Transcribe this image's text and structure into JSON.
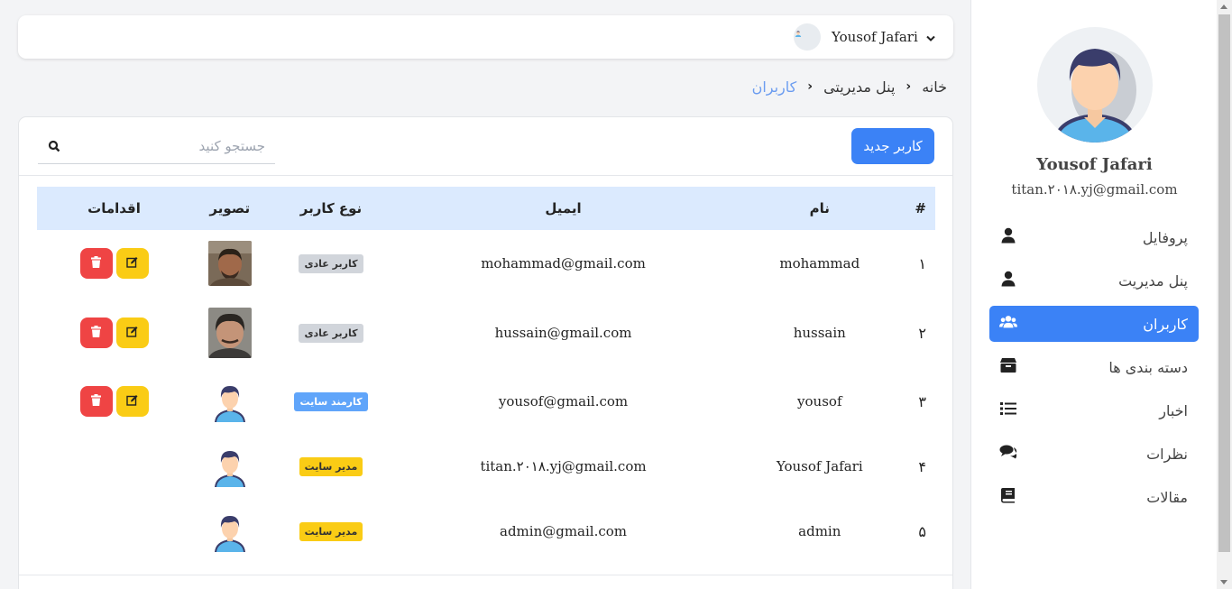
{
  "header": {
    "user_name": "Yousof Jafari"
  },
  "breadcrumb": {
    "home": "خانه",
    "admin_panel": "پنل مدیریتی",
    "current": "کاربران"
  },
  "toolbar": {
    "new_user_label": "کاربر جدید",
    "search_placeholder": "جستجو کنید"
  },
  "table": {
    "headers": {
      "index": "#",
      "name": "نام",
      "email": "ایمیل",
      "type": "نوع کاربر",
      "image": "تصویر",
      "actions": "اقدامات"
    },
    "rows": [
      {
        "index": "۱",
        "name": "mohammad",
        "email": "mohammad@gmail.com",
        "type": "کاربر عادی",
        "type_style": "normal",
        "image": "photo-1",
        "actions": true
      },
      {
        "index": "۲",
        "name": "hussain",
        "email": "hussain@gmail.com",
        "type": "کاربر عادی",
        "type_style": "normal",
        "image": "photo-2",
        "actions": true
      },
      {
        "index": "۳",
        "name": "yousof",
        "email": "yousof@gmail.com",
        "type": "کارمند سایت",
        "type_style": "staff",
        "image": "default-avatar",
        "actions": true
      },
      {
        "index": "۴",
        "name": "Yousof Jafari",
        "email": "titan.۲۰۱۸.yj@gmail.com",
        "type": "مدیر سایت",
        "type_style": "admin",
        "image": "default-avatar",
        "actions": false
      },
      {
        "index": "۵",
        "name": "admin",
        "email": "admin@gmail.com",
        "type": "مدیر سایت",
        "type_style": "admin",
        "image": "default-avatar",
        "actions": false
      }
    ]
  },
  "sidebar": {
    "name": "Yousof Jafari",
    "email": "titan.۲۰۱۸.yj@gmail.com",
    "items": [
      {
        "label": "پروفایل",
        "icon": "user-icon",
        "active": false
      },
      {
        "label": "پنل مدیریت",
        "icon": "user-icon",
        "active": false
      },
      {
        "label": "کاربران",
        "icon": "users-icon",
        "active": true
      },
      {
        "label": "دسته بندی ها",
        "icon": "box-icon",
        "active": false
      },
      {
        "label": "اخبار",
        "icon": "list-icon",
        "active": false
      },
      {
        "label": "نظرات",
        "icon": "comments-icon",
        "active": false
      },
      {
        "label": "مقالات",
        "icon": "book-icon",
        "active": false
      }
    ]
  },
  "colors": {
    "accent": "#3b82f6",
    "danger": "#ef4444",
    "warning": "#facc15",
    "header_row": "#dbeafe"
  }
}
